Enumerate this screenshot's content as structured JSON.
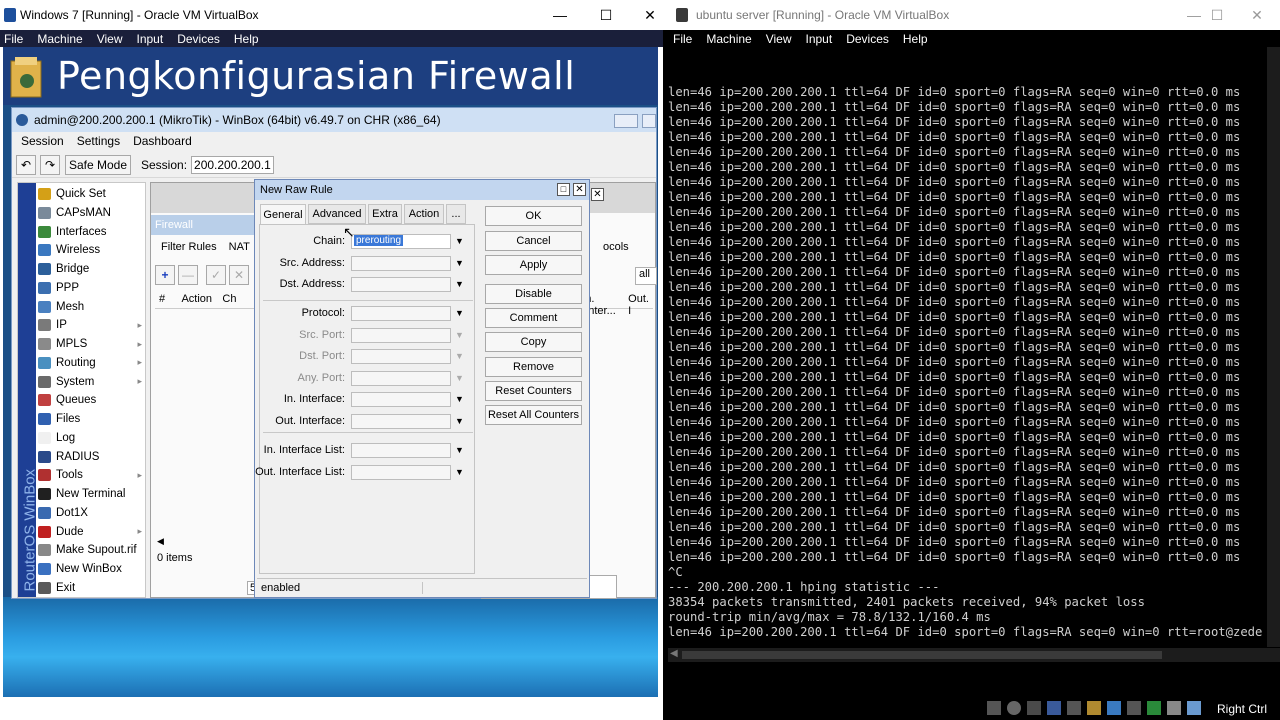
{
  "left_vm": {
    "title": "Windows 7 [Running] - Oracle VM VirtualBox",
    "menu": [
      "File",
      "Machine",
      "View",
      "Input",
      "Devices",
      "Help"
    ]
  },
  "banner": "Pengkonfigurasian Firewall",
  "winbox": {
    "title": "admin@200.200.200.1 (MikroTik) - WinBox (64bit) v6.49.7 on CHR (x86_64)",
    "menu": [
      "Session",
      "Settings",
      "Dashboard"
    ],
    "safe_mode": "Safe Mode",
    "session_label": "Session:",
    "session_value": "200.200.200.1",
    "sidebar_brand": "RouterOS WinBox",
    "sidebar": [
      {
        "label": "Quick Set",
        "color": "#d4a017",
        "arrow": false
      },
      {
        "label": "CAPsMAN",
        "color": "#7a8a9a",
        "arrow": false
      },
      {
        "label": "Interfaces",
        "color": "#3b8a3b",
        "arrow": false
      },
      {
        "label": "Wireless",
        "color": "#3a78c0",
        "arrow": false
      },
      {
        "label": "Bridge",
        "color": "#2c5f9a",
        "arrow": false
      },
      {
        "label": "PPP",
        "color": "#3b6fb0",
        "arrow": false
      },
      {
        "label": "Mesh",
        "color": "#4a80c0",
        "arrow": false
      },
      {
        "label": "IP",
        "color": "#7a7a7a",
        "arrow": true
      },
      {
        "label": "MPLS",
        "color": "#8a8a8a",
        "arrow": true
      },
      {
        "label": "Routing",
        "color": "#4a90c0",
        "arrow": true
      },
      {
        "label": "System",
        "color": "#6a6a6a",
        "arrow": true
      },
      {
        "label": "Queues",
        "color": "#c04040",
        "arrow": false
      },
      {
        "label": "Files",
        "color": "#3060b0",
        "arrow": false
      },
      {
        "label": "Log",
        "color": "#f0f0f0",
        "arrow": false
      },
      {
        "label": "RADIUS",
        "color": "#2a4a8a",
        "arrow": false
      },
      {
        "label": "Tools",
        "color": "#b03030",
        "arrow": true
      },
      {
        "label": "New Terminal",
        "color": "#202020",
        "arrow": false
      },
      {
        "label": "Dot1X",
        "color": "#3a6ab0",
        "arrow": false
      },
      {
        "label": "Dude",
        "color": "#c02020",
        "arrow": true
      },
      {
        "label": "Make Supout.rif",
        "color": "#888888",
        "arrow": false
      },
      {
        "label": "New WinBox",
        "color": "#3a70c0",
        "arrow": false
      },
      {
        "label": "Exit",
        "color": "#5a5a5a",
        "arrow": false
      }
    ],
    "firewall": {
      "title": "Firewall",
      "tabs": [
        "Filter Rules",
        "NAT"
      ],
      "right_tab": "ocols",
      "filter_value": "all",
      "columns": [
        "#",
        "Action",
        "Ch"
      ],
      "right_columns": [
        "n. Inter...",
        "Out. I"
      ],
      "status": "0 items",
      "status2": "5 it"
    }
  },
  "dialog": {
    "title": "New Raw Rule",
    "tabs": [
      "General",
      "Advanced",
      "Extra",
      "Action",
      "..."
    ],
    "fields": [
      {
        "label": "Chain:",
        "value": "prerouting",
        "enabled": true
      },
      {
        "label": "Src. Address:",
        "value": "",
        "enabled": true
      },
      {
        "label": "Dst. Address:",
        "value": "",
        "enabled": true
      },
      {
        "label": "Protocol:",
        "value": "",
        "enabled": true
      },
      {
        "label": "Src. Port:",
        "value": "",
        "enabled": false
      },
      {
        "label": "Dst. Port:",
        "value": "",
        "enabled": false
      },
      {
        "label": "Any. Port:",
        "value": "",
        "enabled": false
      },
      {
        "label": "In. Interface:",
        "value": "",
        "enabled": true
      },
      {
        "label": "Out. Interface:",
        "value": "",
        "enabled": true
      },
      {
        "label": "In. Interface List:",
        "value": "",
        "enabled": true
      },
      {
        "label": "Out. Interface List:",
        "value": "",
        "enabled": true
      }
    ],
    "buttons": [
      "OK",
      "Cancel",
      "Apply",
      "Disable",
      "Comment",
      "Copy",
      "Remove",
      "Reset Counters",
      "Reset All Counters"
    ],
    "status": "enabled"
  },
  "right_vm": {
    "title": "ubuntu server [Running] - Oracle VM VirtualBox",
    "menu": [
      "File",
      "Machine",
      "View",
      "Input",
      "Devices",
      "Help"
    ],
    "right_ctrl": "Right Ctrl",
    "terminal_lines": [
      "len=46 ip=200.200.200.1 ttl=64 DF id=0 sport=0 flags=RA seq=0 win=0 rtt=0.0 ms",
      "len=46 ip=200.200.200.1 ttl=64 DF id=0 sport=0 flags=RA seq=0 win=0 rtt=0.0 ms",
      "len=46 ip=200.200.200.1 ttl=64 DF id=0 sport=0 flags=RA seq=0 win=0 rtt=0.0 ms",
      "len=46 ip=200.200.200.1 ttl=64 DF id=0 sport=0 flags=RA seq=0 win=0 rtt=0.0 ms",
      "len=46 ip=200.200.200.1 ttl=64 DF id=0 sport=0 flags=RA seq=0 win=0 rtt=0.0 ms",
      "len=46 ip=200.200.200.1 ttl=64 DF id=0 sport=0 flags=RA seq=0 win=0 rtt=0.0 ms",
      "len=46 ip=200.200.200.1 ttl=64 DF id=0 sport=0 flags=RA seq=0 win=0 rtt=0.0 ms",
      "len=46 ip=200.200.200.1 ttl=64 DF id=0 sport=0 flags=RA seq=0 win=0 rtt=0.0 ms",
      "len=46 ip=200.200.200.1 ttl=64 DF id=0 sport=0 flags=RA seq=0 win=0 rtt=0.0 ms",
      "len=46 ip=200.200.200.1 ttl=64 DF id=0 sport=0 flags=RA seq=0 win=0 rtt=0.0 ms",
      "len=46 ip=200.200.200.1 ttl=64 DF id=0 sport=0 flags=RA seq=0 win=0 rtt=0.0 ms",
      "len=46 ip=200.200.200.1 ttl=64 DF id=0 sport=0 flags=RA seq=0 win=0 rtt=0.0 ms",
      "len=46 ip=200.200.200.1 ttl=64 DF id=0 sport=0 flags=RA seq=0 win=0 rtt=0.0 ms",
      "len=46 ip=200.200.200.1 ttl=64 DF id=0 sport=0 flags=RA seq=0 win=0 rtt=0.0 ms",
      "len=46 ip=200.200.200.1 ttl=64 DF id=0 sport=0 flags=RA seq=0 win=0 rtt=0.0 ms",
      "len=46 ip=200.200.200.1 ttl=64 DF id=0 sport=0 flags=RA seq=0 win=0 rtt=0.0 ms",
      "len=46 ip=200.200.200.1 ttl=64 DF id=0 sport=0 flags=RA seq=0 win=0 rtt=0.0 ms",
      "len=46 ip=200.200.200.1 ttl=64 DF id=0 sport=0 flags=RA seq=0 win=0 rtt=0.0 ms",
      "len=46 ip=200.200.200.1 ttl=64 DF id=0 sport=0 flags=RA seq=0 win=0 rtt=0.0 ms",
      "len=46 ip=200.200.200.1 ttl=64 DF id=0 sport=0 flags=RA seq=0 win=0 rtt=0.0 ms",
      "len=46 ip=200.200.200.1 ttl=64 DF id=0 sport=0 flags=RA seq=0 win=0 rtt=0.0 ms",
      "len=46 ip=200.200.200.1 ttl=64 DF id=0 sport=0 flags=RA seq=0 win=0 rtt=0.0 ms",
      "len=46 ip=200.200.200.1 ttl=64 DF id=0 sport=0 flags=RA seq=0 win=0 rtt=0.0 ms",
      "len=46 ip=200.200.200.1 ttl=64 DF id=0 sport=0 flags=RA seq=0 win=0 rtt=0.0 ms",
      "len=46 ip=200.200.200.1 ttl=64 DF id=0 sport=0 flags=RA seq=0 win=0 rtt=0.0 ms",
      "len=46 ip=200.200.200.1 ttl=64 DF id=0 sport=0 flags=RA seq=0 win=0 rtt=0.0 ms",
      "len=46 ip=200.200.200.1 ttl=64 DF id=0 sport=0 flags=RA seq=0 win=0 rtt=0.0 ms",
      "len=46 ip=200.200.200.1 ttl=64 DF id=0 sport=0 flags=RA seq=0 win=0 rtt=0.0 ms",
      "len=46 ip=200.200.200.1 ttl=64 DF id=0 sport=0 flags=RA seq=0 win=0 rtt=0.0 ms",
      "len=46 ip=200.200.200.1 ttl=64 DF id=0 sport=0 flags=RA seq=0 win=0 rtt=0.0 ms",
      "len=46 ip=200.200.200.1 ttl=64 DF id=0 sport=0 flags=RA seq=0 win=0 rtt=0.0 ms",
      "len=46 ip=200.200.200.1 ttl=64 DF id=0 sport=0 flags=RA seq=0 win=0 rtt=0.0 ms",
      "^C",
      "--- 200.200.200.1 hping statistic ---",
      "38354 packets transmitted, 2401 packets received, 94% packet loss",
      "round-trip min/avg/max = 78.8/132.1/160.4 ms",
      "len=46 ip=200.200.200.1 ttl=64 DF id=0 sport=0 flags=RA seq=0 win=0 rtt=root@zede"
    ]
  }
}
